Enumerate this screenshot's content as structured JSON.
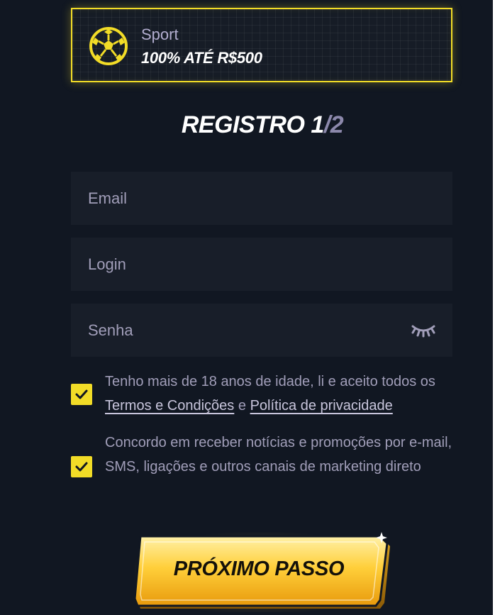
{
  "bonus": {
    "category": "Sport",
    "offer": "100% ATÉ R$500",
    "icon": "soccer-ball-icon"
  },
  "form": {
    "title_main": "REGISTRO 1",
    "title_total": "/2",
    "email_placeholder": "Email",
    "login_placeholder": "Login",
    "password_placeholder": "Senha",
    "password_icon": "eye-closed-icon"
  },
  "consents": {
    "age": {
      "checked": true,
      "text_before": "Tenho mais de 18 anos de idade, li e aceito todos os ",
      "terms_link": "Termos e Condições",
      "connector": " e ",
      "privacy_link": "Política de privacidade"
    },
    "marketing": {
      "checked": true,
      "text": "Concordo em receber notícias e promoções por e-mail, SMS, ligações e outros canais de marketing direto"
    }
  },
  "next_button": {
    "label": "PRÓXIMO PASSO"
  },
  "colors": {
    "background": "#111722",
    "field": "#181e29",
    "accent_yellow": "#f2dc27",
    "muted_text": "#a19eb9"
  }
}
